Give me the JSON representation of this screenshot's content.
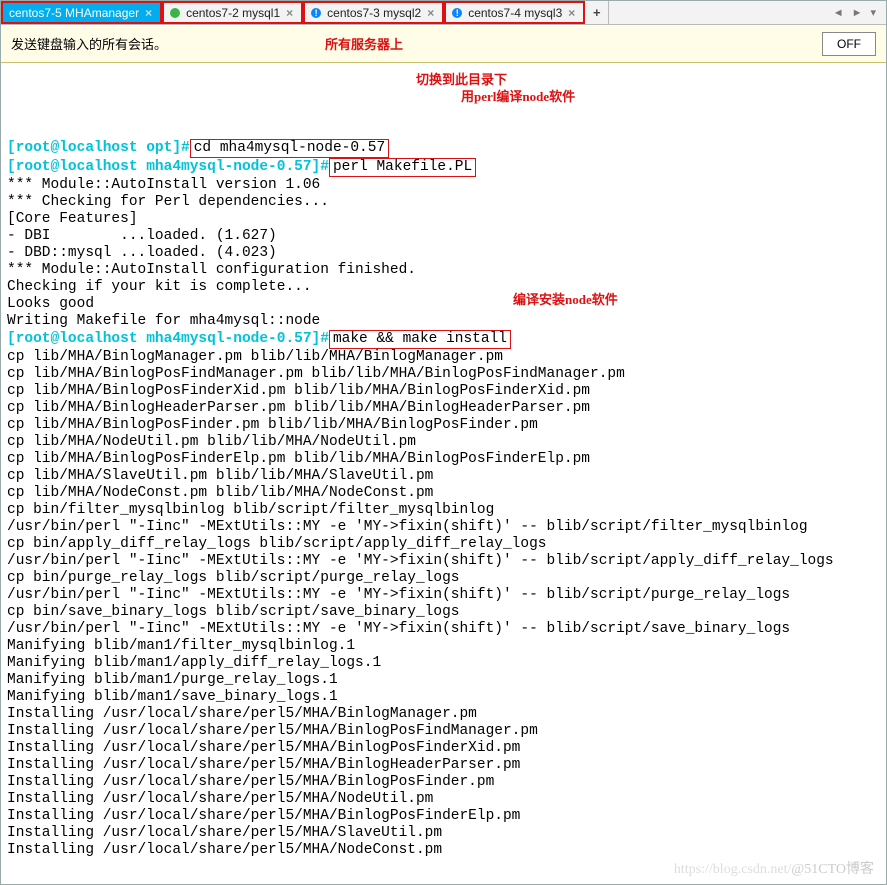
{
  "tabs": {
    "t0": "centos7-5 MHAmanager",
    "t1": "centos7-2 mysql1",
    "t2": "centos7-3 mysql2",
    "t3": "centos7-4 mysql3"
  },
  "nav": {
    "left": "◄",
    "right": "►",
    "menu": "▾",
    "plus": "+",
    "x": "×",
    "bang": "!"
  },
  "toolbar": {
    "hint": "发送键盘输入的所有会话。",
    "red": "所有服务器上",
    "off": "OFF"
  },
  "anno": {
    "a1": "切换到此目录下",
    "a2": "用perl编译node软件",
    "a3": "编译安装node软件"
  },
  "prompt": {
    "p1": "[root@localhost opt]#",
    "p2": "[root@localhost mha4mysql-node-0.57]#",
    "p3": "[root@localhost mha4mysql-node-0.57]#"
  },
  "cmd": {
    "c1": "cd mha4mysql-node-0.57",
    "c2": "perl Makefile.PL",
    "c3": "make && make install"
  },
  "out": {
    "l01": "*** Module::AutoInstall version 1.06",
    "l02": "*** Checking for Perl dependencies...",
    "l03": "[Core Features]",
    "l04": "- DBI        ...loaded. (1.627)",
    "l05": "- DBD::mysql ...loaded. (4.023)",
    "l06": "*** Module::AutoInstall configuration finished.",
    "l07": "Checking if your kit is complete...",
    "l08": "Looks good",
    "l09": "Writing Makefile for mha4mysql::node",
    "l10": "cp lib/MHA/BinlogManager.pm blib/lib/MHA/BinlogManager.pm",
    "l11": "cp lib/MHA/BinlogPosFindManager.pm blib/lib/MHA/BinlogPosFindManager.pm",
    "l12": "cp lib/MHA/BinlogPosFinderXid.pm blib/lib/MHA/BinlogPosFinderXid.pm",
    "l13": "cp lib/MHA/BinlogHeaderParser.pm blib/lib/MHA/BinlogHeaderParser.pm",
    "l14": "cp lib/MHA/BinlogPosFinder.pm blib/lib/MHA/BinlogPosFinder.pm",
    "l15": "cp lib/MHA/NodeUtil.pm blib/lib/MHA/NodeUtil.pm",
    "l16": "cp lib/MHA/BinlogPosFinderElp.pm blib/lib/MHA/BinlogPosFinderElp.pm",
    "l17": "cp lib/MHA/SlaveUtil.pm blib/lib/MHA/SlaveUtil.pm",
    "l18": "cp lib/MHA/NodeConst.pm blib/lib/MHA/NodeConst.pm",
    "l19": "cp bin/filter_mysqlbinlog blib/script/filter_mysqlbinlog",
    "l20": "/usr/bin/perl \"-Iinc\" -MExtUtils::MY -e 'MY->fixin(shift)' -- blib/script/filter_mysqlbinlog",
    "l21": "cp bin/apply_diff_relay_logs blib/script/apply_diff_relay_logs",
    "l22": "/usr/bin/perl \"-Iinc\" -MExtUtils::MY -e 'MY->fixin(shift)' -- blib/script/apply_diff_relay_logs",
    "l23": "cp bin/purge_relay_logs blib/script/purge_relay_logs",
    "l24": "/usr/bin/perl \"-Iinc\" -MExtUtils::MY -e 'MY->fixin(shift)' -- blib/script/purge_relay_logs",
    "l25": "cp bin/save_binary_logs blib/script/save_binary_logs",
    "l26": "/usr/bin/perl \"-Iinc\" -MExtUtils::MY -e 'MY->fixin(shift)' -- blib/script/save_binary_logs",
    "l27": "Manifying blib/man1/filter_mysqlbinlog.1",
    "l28": "Manifying blib/man1/apply_diff_relay_logs.1",
    "l29": "Manifying blib/man1/purge_relay_logs.1",
    "l30": "Manifying blib/man1/save_binary_logs.1",
    "l31": "Installing /usr/local/share/perl5/MHA/BinlogManager.pm",
    "l32": "Installing /usr/local/share/perl5/MHA/BinlogPosFindManager.pm",
    "l33": "Installing /usr/local/share/perl5/MHA/BinlogPosFinderXid.pm",
    "l34": "Installing /usr/local/share/perl5/MHA/BinlogHeaderParser.pm",
    "l35": "Installing /usr/local/share/perl5/MHA/BinlogPosFinder.pm",
    "l36": "Installing /usr/local/share/perl5/MHA/NodeUtil.pm",
    "l37": "Installing /usr/local/share/perl5/MHA/BinlogPosFinderElp.pm",
    "l38": "Installing /usr/local/share/perl5/MHA/SlaveUtil.pm",
    "l39": "Installing /usr/local/share/perl5/MHA/NodeConst.pm"
  },
  "wm": {
    "a": "https://blog.csdn.net/",
    "b": "@51CTO博客"
  }
}
